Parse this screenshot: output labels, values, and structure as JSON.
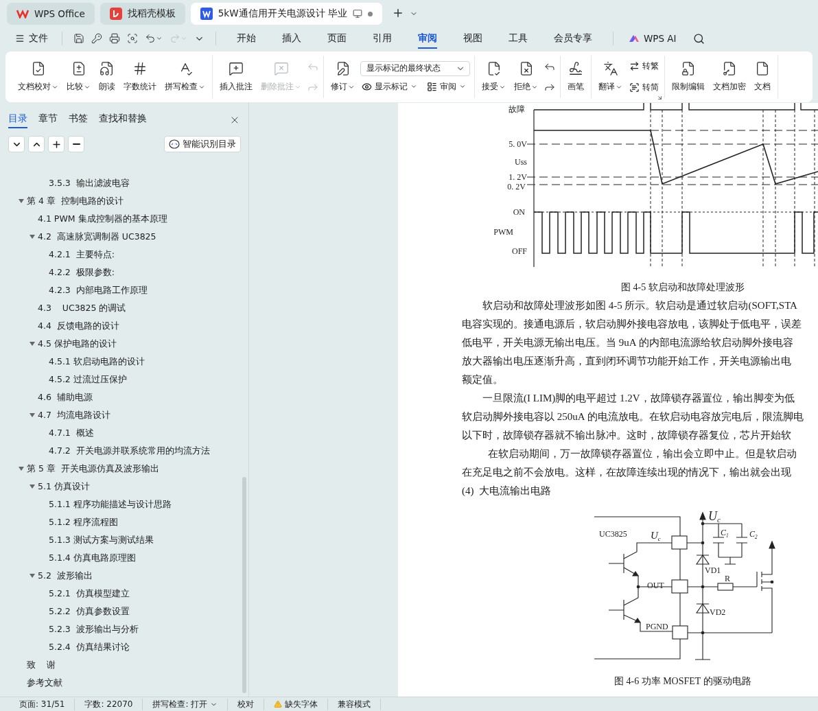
{
  "tabs": [
    {
      "label": "WPS Office",
      "kind": "wps",
      "selected": false,
      "unsaved": false
    },
    {
      "label": "找稻壳模板",
      "kind": "docer",
      "selected": false,
      "unsaved": false
    },
    {
      "label": "5kW通信用开关电源设计 毕业",
      "kind": "writer",
      "selected": true,
      "unsaved": true
    }
  ],
  "file_menu": "文件",
  "quick_access": [
    {
      "disabled": false
    },
    {
      "disabled": false
    },
    {
      "disabled": false
    },
    {
      "disabled": false
    },
    {
      "disabled": false
    },
    {
      "disabled": true
    }
  ],
  "menu_tabs": [
    {
      "label": "开始",
      "selected": false
    },
    {
      "label": "插入",
      "selected": false
    },
    {
      "label": "页面",
      "selected": false
    },
    {
      "label": "引用",
      "selected": false
    },
    {
      "label": "审阅",
      "selected": true
    },
    {
      "label": "视图",
      "selected": false
    },
    {
      "label": "工具",
      "selected": false
    },
    {
      "label": "会员专享",
      "selected": false
    }
  ],
  "ai_button": "WPS AI",
  "ribbon": {
    "groups": [
      {
        "tools": [
          {
            "kind": "large",
            "label": "文档校对",
            "dropdown": true,
            "disabled": false
          },
          {
            "kind": "large",
            "label": "比较",
            "dropdown": true,
            "disabled": false
          },
          {
            "kind": "large",
            "label": "朗读",
            "dropdown": false,
            "disabled": false
          },
          {
            "kind": "large",
            "label": "字数统计",
            "dropdown": false,
            "disabled": false
          },
          {
            "kind": "large",
            "label": "拼写检查",
            "dropdown": true,
            "disabled": false
          }
        ]
      },
      {
        "tools": [
          {
            "kind": "large",
            "label": "插入批注",
            "dropdown": false,
            "disabled": false
          },
          {
            "kind": "large",
            "label": "删除批注",
            "dropdown": true,
            "disabled": true
          },
          {
            "kind": "stack",
            "disabled": true
          }
        ]
      },
      {
        "tools": [
          {
            "kind": "large",
            "label": "修订",
            "dropdown": true,
            "disabled": false
          },
          {
            "kind": "panel",
            "select": "显示标记的最终状态",
            "buttons": [
              {
                "label": "显示标记",
                "dropdown": true
              },
              {
                "label": "审阅",
                "dropdown": true
              }
            ]
          }
        ]
      },
      {
        "tools": [
          {
            "kind": "large",
            "label": "接受",
            "dropdown": true,
            "disabled": false
          },
          {
            "kind": "large",
            "label": "拒绝",
            "dropdown": true,
            "disabled": false
          },
          {
            "kind": "stack",
            "disabled": false
          }
        ]
      },
      {
        "tools": [
          {
            "kind": "large",
            "label": "画笔",
            "dropdown": false,
            "disabled": false
          }
        ]
      },
      {
        "launcher": true,
        "tools": [
          {
            "kind": "large",
            "label": "翻译",
            "dropdown": true,
            "disabled": false
          },
          {
            "kind": "column",
            "buttons": [
              {
                "label": "转繁",
                "dropdown": false
              },
              {
                "label": "转简",
                "dropdown": false
              }
            ]
          }
        ]
      },
      {
        "tools": [
          {
            "kind": "large",
            "label": "限制编辑",
            "dropdown": false,
            "disabled": false
          },
          {
            "kind": "large",
            "label": "文档加密",
            "dropdown": false,
            "disabled": false
          },
          {
            "kind": "large",
            "label": "文档",
            "dropdown": false,
            "disabled": false
          }
        ]
      }
    ]
  },
  "nav_panel": {
    "tabs": [
      {
        "label": "目录",
        "selected": true
      },
      {
        "label": "章节",
        "selected": false
      },
      {
        "label": "书签",
        "selected": false
      },
      {
        "label": "查找和替换",
        "selected": false
      }
    ],
    "smart_toc_button": "智能识别目录",
    "leading_items": [
      {
        "label": "3.5.3  输出滤波电容"
      }
    ],
    "items": [
      {
        "label": "第 4 章  控制电路的设计",
        "expanded": true,
        "children": [
          {
            "label": "4.1 PWM 集成控制器的基本原理"
          },
          {
            "label": "4.2  高速脉宽调制器 UC3825",
            "expanded": true,
            "children": [
              {
                "label": "4.2.1  主要特点:"
              },
              {
                "label": "4.2.2  极限参数:"
              },
              {
                "label": "4.2.3  内部电路工作原理"
              }
            ]
          },
          {
            "label": "4.3    UC3825 的调试"
          },
          {
            "label": "4.4  反馈电路的设计"
          },
          {
            "label": "4.5 保护电路的设计",
            "expanded": true,
            "children": [
              {
                "label": "4.5.1 软启动电路的设计"
              },
              {
                "label": "4.5.2 过流过压保护"
              }
            ]
          },
          {
            "label": "4.6  辅助电源"
          },
          {
            "label": "4.7  均流电路设计",
            "expanded": true,
            "children": [
              {
                "label": "4.7.1  概述"
              },
              {
                "label": "4.7.2  开关电源并联系统常用的均流方法"
              }
            ]
          }
        ]
      },
      {
        "label": "第 5 章  开关电源仿真及波形输出",
        "expanded": true,
        "children": [
          {
            "label": "5.1 仿真设计",
            "expanded": true,
            "children": [
              {
                "label": "5.1.1 程序功能描述与设计思路"
              },
              {
                "label": "5.1.2 程序流程图"
              },
              {
                "label": "5.1.3 测试方案与测试结果"
              },
              {
                "label": "5.1.4 仿真电路原理图"
              }
            ]
          },
          {
            "label": "5.2  波形输出",
            "expanded": true,
            "children": [
              {
                "label": "5.2.1  仿真模型建立"
              },
              {
                "label": "5.2.2  仿真参数设置"
              },
              {
                "label": "5.2.3  波形输出与分析"
              },
              {
                "label": "5.2.4  仿真结果讨论"
              }
            ]
          }
        ]
      },
      {
        "label": "致    谢"
      },
      {
        "label": "参考文献"
      }
    ]
  },
  "document": {
    "waveform_figure": {
      "labels": [
        "故障",
        "5. 0V",
        "Uss",
        "1. 2V",
        "0. 2V",
        "ON",
        "PWM",
        "OFF"
      ],
      "caption": "图 4-5 软启动和故障处理波形"
    },
    "lines": [
      {
        "kind": "first",
        "text": "软启动和故障处理波形如图 4-5 所示。软启动是通过软启动(SOFT,STA"
      },
      {
        "kind": "cont",
        "text": "电容实现的。接通电源后，软启动脚外接电容放电，该脚处于低电平，误差"
      },
      {
        "kind": "cont",
        "text": "低电平，开关电源无输出电压。当 9uA 的内部电流源给软启动脚外接电容"
      },
      {
        "kind": "cont",
        "text": "放大器输出电压逐渐升高，直到闭环调节功能开始工作，开关电源输出电"
      },
      {
        "kind": "cont",
        "text": "额定值。"
      },
      {
        "kind": "first",
        "text": "一旦限流(I LIM)脚的电平超过 1.2V，故障锁存器置位，输出脚变为低"
      },
      {
        "kind": "cont",
        "text": "软启动脚外接电容以 250uA 的电流放电。在软启动电容放完电后，限流脚电"
      },
      {
        "kind": "cont",
        "text": "以下时，故障锁存器就不输出脉冲。这时，故障锁存器复位，芯片开始软"
      },
      {
        "kind": "deep",
        "text": "在软启动期间，万一故障锁存器置位，输出会立即中止。但是软启动"
      },
      {
        "kind": "cont",
        "text": "在充足电之前不会放电。这样，在故障连续出现的情况下，输出就会出现"
      },
      {
        "kind": "cont",
        "text": "(4)  大电流输出电路"
      }
    ],
    "circuit_figure": {
      "labels": [
        {
          "text": "UC3825"
        },
        {
          "text": "U",
          "sub": "c"
        },
        {
          "text": "OUT"
        },
        {
          "text": "PGND"
        },
        {
          "text": "U",
          "sub": "c"
        },
        {
          "text": "C",
          "sub": "1"
        },
        {
          "text": "C",
          "sub": "2"
        },
        {
          "text": "VD1"
        },
        {
          "text": "R"
        },
        {
          "text": "VD2"
        }
      ],
      "caption": "图 4-6 功率 MOSFET 的驱动电路"
    }
  },
  "status_bar": [
    {
      "kind": "text",
      "label": "页面: 31/51"
    },
    {
      "kind": "text",
      "label": "字数: 22070"
    },
    {
      "kind": "dropdown",
      "label": "拼写检查: 打开"
    },
    {
      "kind": "text",
      "label": "校对"
    },
    {
      "kind": "warning",
      "label": "缺失字体"
    },
    {
      "kind": "text",
      "label": "兼容模式"
    }
  ]
}
